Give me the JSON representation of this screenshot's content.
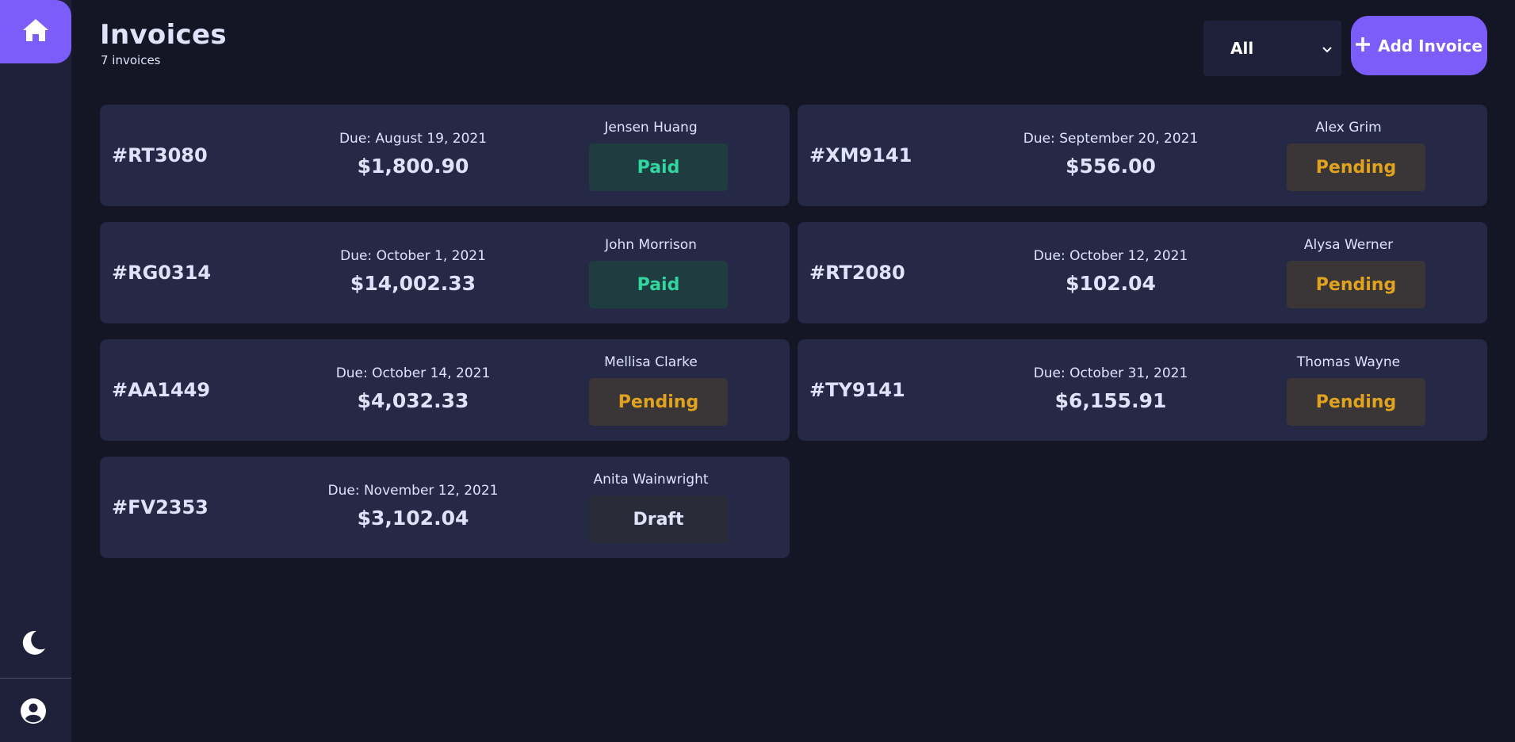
{
  "sidebar": {
    "logo_icon": "home-icon",
    "theme_icon": "moon-icon",
    "avatar_icon": "user-circle-icon"
  },
  "header": {
    "title": "Invoices",
    "subtitle": "7 invoices"
  },
  "filter": {
    "selected": "All",
    "icon": "chevron-down-icon"
  },
  "add_button": {
    "label": "Add Invoice",
    "icon": "plus-icon"
  },
  "colors": {
    "accent": "#7c5dfa",
    "background": "#141625",
    "card": "#252945",
    "paid": "#33d69f",
    "pending": "#e0a21f",
    "draft": "#dfe3fa"
  },
  "invoices": [
    {
      "id": "#RT3080",
      "due": "Due: August 19, 2021",
      "amount": "$1,800.90",
      "client": "Jensen Huang",
      "status": "Paid"
    },
    {
      "id": "#XM9141",
      "due": "Due: September 20, 2021",
      "amount": "$556.00",
      "client": "Alex Grim",
      "status": "Pending"
    },
    {
      "id": "#RG0314",
      "due": "Due: October 1, 2021",
      "amount": "$14,002.33",
      "client": "John Morrison",
      "status": "Paid"
    },
    {
      "id": "#RT2080",
      "due": "Due: October 12, 2021",
      "amount": "$102.04",
      "client": "Alysa Werner",
      "status": "Pending"
    },
    {
      "id": "#AA1449",
      "due": "Due: October 14, 2021",
      "amount": "$4,032.33",
      "client": "Mellisa Clarke",
      "status": "Pending"
    },
    {
      "id": "#TY9141",
      "due": "Due: October 31, 2021",
      "amount": "$6,155.91",
      "client": "Thomas Wayne",
      "status": "Pending"
    },
    {
      "id": "#FV2353",
      "due": "Due: November 12, 2021",
      "amount": "$3,102.04",
      "client": "Anita Wainwright",
      "status": "Draft"
    }
  ]
}
